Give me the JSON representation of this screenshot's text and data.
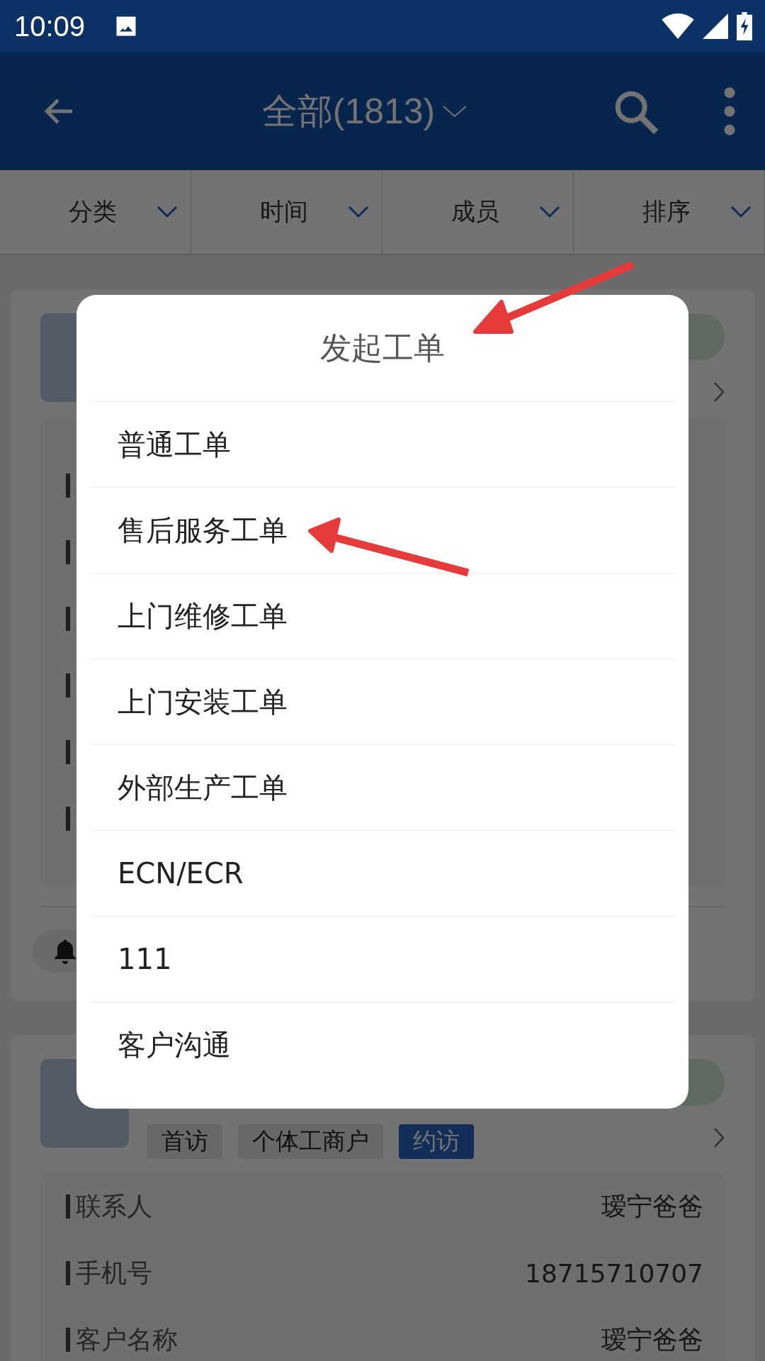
{
  "status_bar": {
    "time": "10:09"
  },
  "app_bar": {
    "title": "全部(1813)"
  },
  "filters": [
    {
      "label": "分类"
    },
    {
      "label": "时间"
    },
    {
      "label": "成员"
    },
    {
      "label": "排序"
    }
  ],
  "cards": [
    {
      "kind": "reminder"
    },
    {
      "kind": "contact",
      "tags": [
        {
          "label": "首访",
          "highlighted": false
        },
        {
          "label": "个体工商户",
          "highlighted": false
        },
        {
          "label": "约访",
          "highlighted": true
        }
      ],
      "fields": [
        {
          "label": "联系人",
          "value": "瑷宁爸爸"
        },
        {
          "label": "手机号",
          "value": "18715710707"
        },
        {
          "label": "客户名称",
          "value": "瑷宁爸爸"
        }
      ]
    }
  ],
  "dialog": {
    "title": "发起工单",
    "items": [
      "普通工单",
      "售后服务工单",
      "上门维修工单",
      "上门安装工单",
      "外部生产工单",
      "ECN/ECR",
      "111",
      "客户沟通"
    ]
  }
}
